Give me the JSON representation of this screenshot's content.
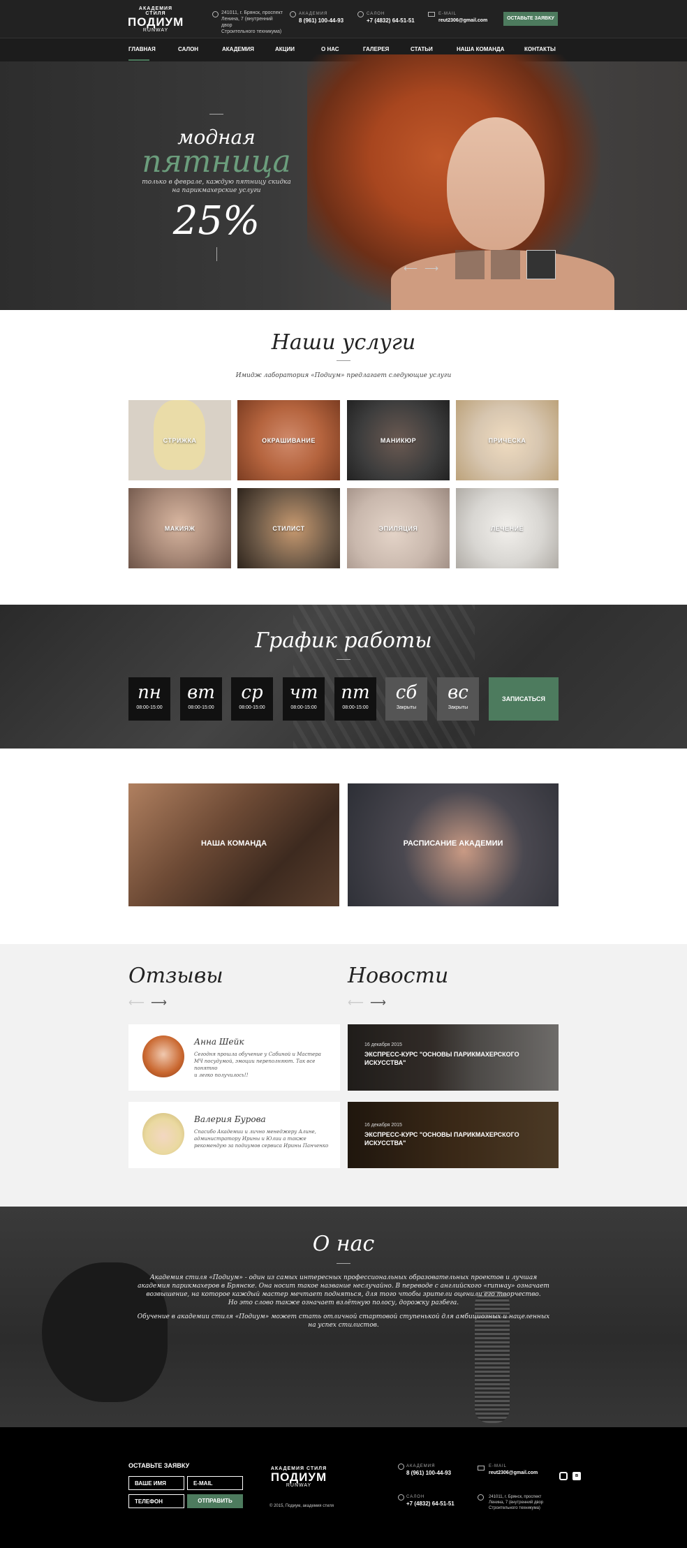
{
  "header": {
    "logo_top": "АКАДЕМИЯ СТИЛЯ",
    "logo_main": "ПОДИУМ",
    "logo_sub": "RUNWAY",
    "address_lines": [
      "241011, г. Брянск, проспект",
      "Ленина, 7 (внутренний двор",
      "Строительного техникума)"
    ],
    "phone1_caption": "АКАДЕМИЯ",
    "phone1": "8 (961) 100-44-93",
    "phone2_caption": "САЛОН",
    "phone2": "+7 (4832) 64-51-51",
    "email_caption": "E-MAIL",
    "email": "reut2306@gmail.com",
    "cta": "ОСТАВЬТЕ ЗАЯВКУ"
  },
  "nav": [
    "ГЛАВНАЯ",
    "САЛОН",
    "АКАДЕМИЯ",
    "АКЦИИ",
    "О НАС",
    "ГАЛЕРЕЯ",
    "СТАТЬИ",
    "НАША КОМАНДА",
    "КОНТАКТЫ"
  ],
  "hero": {
    "line1": "модная",
    "line2": "пятница",
    "text1": "только в феврале, каждую пятницу скидка",
    "text2": "на парикмахерские услуги",
    "discount": "25%"
  },
  "services": {
    "title": "Наши услуги",
    "subtitle": "Имидж лаборатория «Подиум» предлагает следующие услуги",
    "items": [
      "СТРИЖКА",
      "ОКРАШИВАНИЕ",
      "МАНИКЮР",
      "ПРИЧЕСКА",
      "МАКИЯЖ",
      "СТИЛИСТ",
      "ЭПИЛЯЦИЯ",
      "ЛЕЧЕНИЕ"
    ],
    "colors": [
      "#d9d1c6",
      "#b5643e",
      "#3d3d3d",
      "#d7c6b0",
      "#a88978",
      "#6d5a48",
      "#c9b8ad",
      "#d8d6d2"
    ]
  },
  "schedule": {
    "title": "График работы",
    "days": [
      {
        "d": "пн",
        "h": "08:00-15:00"
      },
      {
        "d": "вт",
        "h": "08:00-15:00"
      },
      {
        "d": "ср",
        "h": "08:00-15:00"
      },
      {
        "d": "чт",
        "h": "08:00-15:00"
      },
      {
        "d": "пт",
        "h": "08:00-15:00"
      },
      {
        "d": "сб",
        "h": "Закрыты"
      },
      {
        "d": "вс",
        "h": "Закрыты"
      }
    ],
    "button": "ЗАПИСАТЬСЯ"
  },
  "promo": {
    "team": "НАША КОМАНДА",
    "academy": "РАСПИСАНИЕ АКАДЕМИИ"
  },
  "reviews": {
    "title": "Отзывы",
    "items": [
      {
        "name": "Анна Шейк",
        "text": [
          "Сегодня прошла обучение у Сабиной и Мастера",
          "МЧ посудумой, эмоции переполняют. Так все понятно",
          "и легко получилось!!"
        ]
      },
      {
        "name": "Валерия Бурова",
        "text": [
          "Спасибо Академии и лично менеджеру Алине,",
          "администратору Ирины и Юлии а также",
          "рекомендую за подиумов сервиса Ирины Панченко"
        ]
      }
    ]
  },
  "news": {
    "title": "Новости",
    "items": [
      {
        "date": "16 декабря 2015",
        "title": [
          "ЭКСПРЕСС-КУРС \"ОСНОВЫ ПАРИКМАХЕРСКОГО",
          "ИСКУССТВА\""
        ]
      },
      {
        "date": "16 декабря 2015",
        "title": [
          "ЭКСПРЕСС-КУРС \"ОСНОВЫ ПАРИКМАХЕРСКОГО",
          "ИСКУССТВА\""
        ]
      }
    ]
  },
  "about": {
    "title": "О нас",
    "p1": [
      "Академия стиля «Подиум» - один из самых интересных профессиональных образовательных проектов и лучшая",
      "академия парикмахеров в Брянске. Она носит такое название неслучайно. В переводе с английского «runway» означает",
      "возвышение, на которое каждый мастер мечтает подняться, для того чтобы зрители оценили его творчество.",
      "Но это слово также означает взлётную полосу, дорожку разбега."
    ],
    "p2": [
      "Обучение в академии стиля «Подиум» может стать отличной стартовой ступенькой для амбициозных и нацеленных",
      "на успех стилистов."
    ]
  },
  "footer": {
    "form_title": "ОСТАВЬТЕ ЗАЯВКУ",
    "name": "ВАШЕ ИМЯ",
    "email": "E-MAIL",
    "phone": "ТЕЛЕФОН",
    "submit": "ОТПРАВИТЬ",
    "copyright": "© 2015, Подиум, академия стиля",
    "phone1_caption": "АКАДЕМИЯ",
    "phone1": "8 (961) 100-44-93",
    "phone2_caption": "САЛОН",
    "phone2": "+7 (4832) 64-51-51",
    "email_caption": "E-MAIL",
    "email_value": "reut2306@gmail.com",
    "address_lines": [
      "241011, г. Брянск, проспект",
      "Ленина, 7 (внутренний двор",
      "Строительного техникума)"
    ],
    "social1": "instagram",
    "social2": "vk"
  },
  "colors": {
    "accent": "#4d7b5e",
    "dark": "#222222"
  }
}
